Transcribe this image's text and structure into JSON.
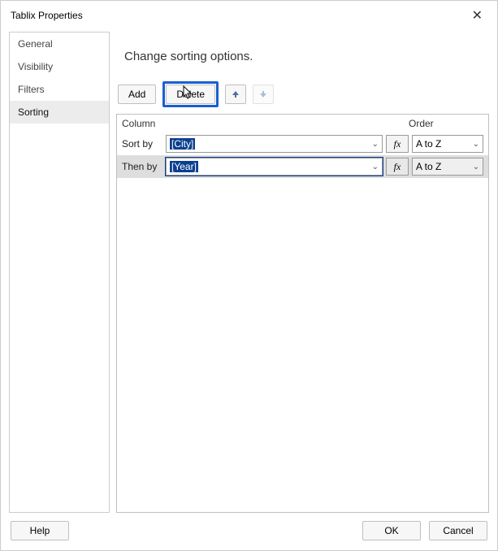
{
  "dialog": {
    "title": "Tablix Properties"
  },
  "sidebar": {
    "items": [
      {
        "label": "General"
      },
      {
        "label": "Visibility"
      },
      {
        "label": "Filters"
      },
      {
        "label": "Sorting"
      }
    ],
    "selected_index": 3
  },
  "main": {
    "heading": "Change sorting options.",
    "toolbar": {
      "add_label": "Add",
      "delete_label": "Delete"
    },
    "columns": {
      "column_label": "Column",
      "order_label": "Order"
    },
    "rows": [
      {
        "label": "Sort by",
        "value": "[City]",
        "order": "A to Z",
        "fx": "fx"
      },
      {
        "label": "Then by",
        "value": "[Year]",
        "order": "A to Z",
        "fx": "fx"
      }
    ],
    "selected_row_index": 1
  },
  "footer": {
    "help_label": "Help",
    "ok_label": "OK",
    "cancel_label": "Cancel"
  }
}
